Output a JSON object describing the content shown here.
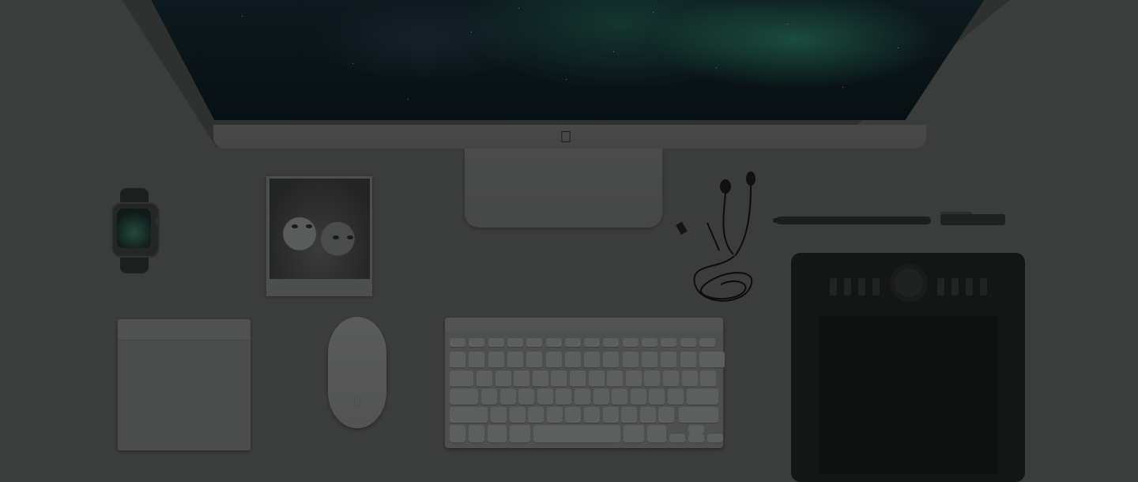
{
  "scene": {
    "objects": [
      "imac",
      "apple-watch",
      "polaroid-photo",
      "earphones",
      "stylus-pen",
      "drawing-tablet",
      "trackpad",
      "mouse",
      "keyboard"
    ]
  },
  "colors": {
    "background": "#3b3c3c",
    "screen_glow": "#2a7a5a",
    "device_dark": "#141515",
    "device_silver": "#4e4f4f"
  },
  "icons": {
    "imac_logo": "apple-logo-icon",
    "mouse_logo": "apple-logo-icon"
  }
}
